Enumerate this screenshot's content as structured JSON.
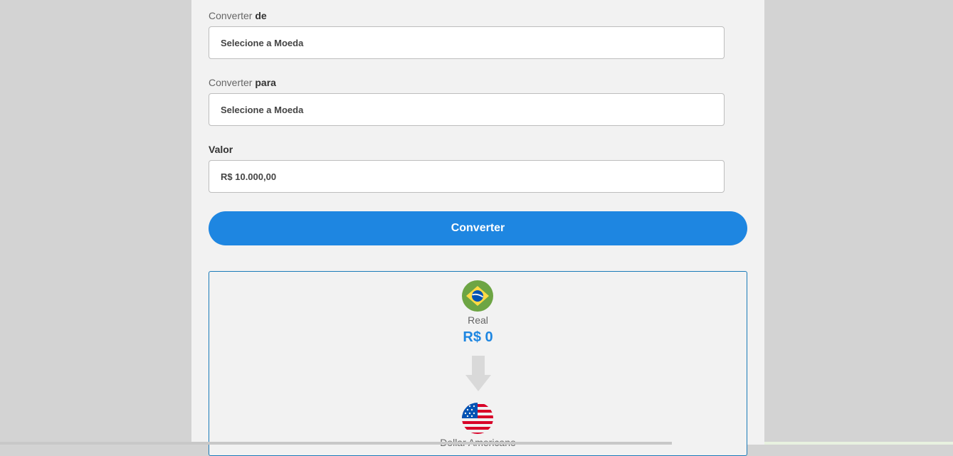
{
  "form": {
    "from_label_prefix": "Converter ",
    "from_label_bold": "de",
    "from_select_value": "Selecione a Moeda",
    "to_label_prefix": "Converter ",
    "to_label_bold": "para",
    "to_select_value": "Selecione a Moeda",
    "amount_label": "Valor",
    "amount_value": "R$ 10.000,00",
    "convert_button": "Converter"
  },
  "result": {
    "from_currency_name": "Real",
    "from_currency_value": "R$ 0",
    "from_flag_icon": "brazil-flag-icon",
    "arrow_icon": "arrow-down-icon",
    "to_currency_name": "Dollar Americano",
    "to_flag_icon": "usa-flag-icon"
  },
  "colors": {
    "accent": "#1e86e1",
    "panel_bg": "#f2f2f2",
    "page_bg": "#d3d3d3",
    "result_border": "#1a7ab8"
  }
}
